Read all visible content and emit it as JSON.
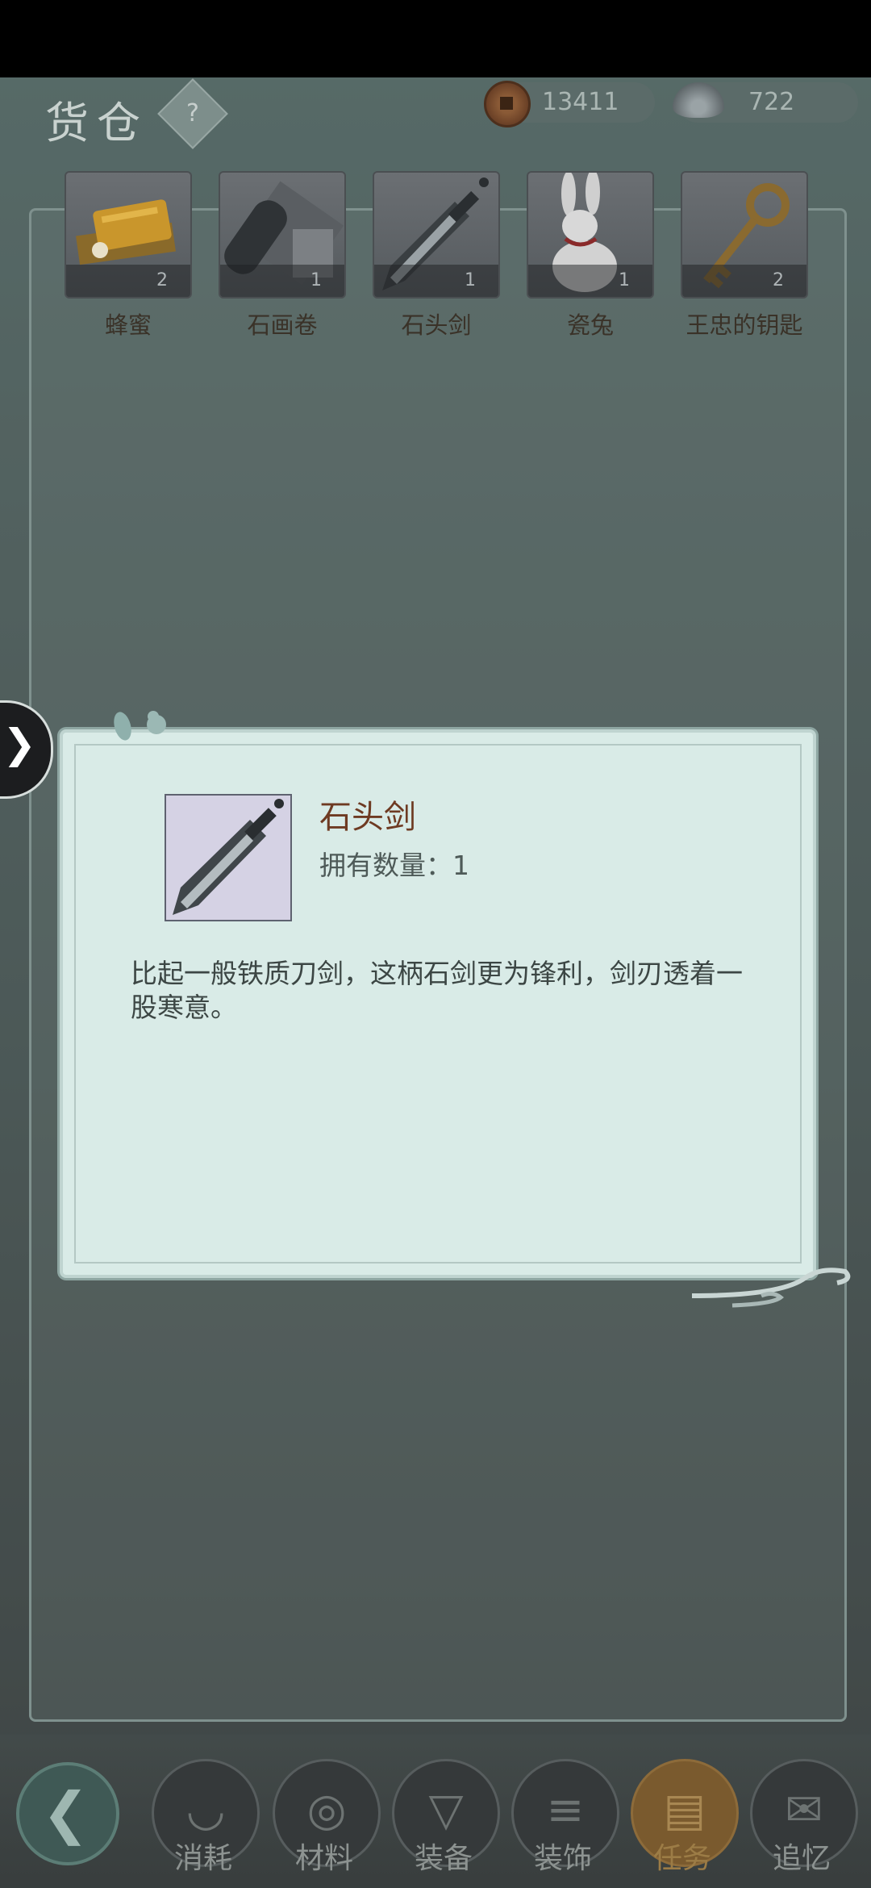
{
  "header": {
    "title": "货仓",
    "help_label": "?",
    "coins": "13411",
    "silver": "722"
  },
  "inventory": [
    {
      "name": "蜂蜜",
      "count": "2",
      "icon": "honey-icon"
    },
    {
      "name": "石画卷",
      "count": "1",
      "icon": "scroll-icon"
    },
    {
      "name": "石头剑",
      "count": "1",
      "icon": "sword-icon"
    },
    {
      "name": "瓷兔",
      "count": "1",
      "icon": "rabbit-icon"
    },
    {
      "name": "王忠的钥匙",
      "count": "2",
      "icon": "key-icon"
    }
  ],
  "detail": {
    "name": "石头剑",
    "owned": "拥有数量：1",
    "description": "比起一般铁质刀剑，这柄石剑更为锋利，剑刃透着一股寒意。"
  },
  "tabs": [
    {
      "label": "消耗",
      "icon": "bowl-icon"
    },
    {
      "label": "材料",
      "icon": "logs-icon"
    },
    {
      "label": "装备",
      "icon": "robe-icon"
    },
    {
      "label": "装饰",
      "icon": "gate-icon"
    },
    {
      "label": "任务",
      "icon": "task-scroll-icon",
      "active": true
    },
    {
      "label": "追忆",
      "icon": "letter-icon"
    }
  ],
  "colors": {
    "popup_bg": "#d9ebe7",
    "item_name": "#6e3a22",
    "active_tab": "#7a5a2e"
  }
}
